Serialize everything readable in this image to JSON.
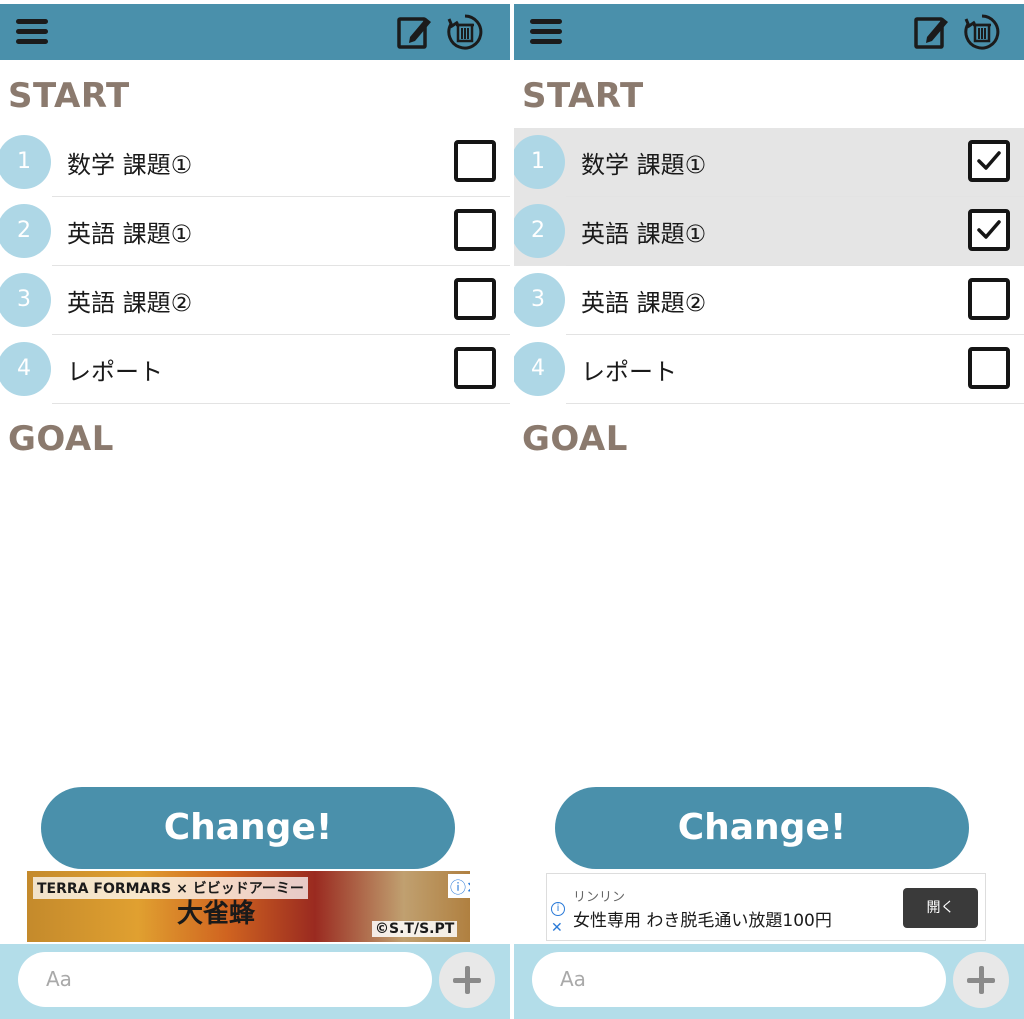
{
  "left_screen": {
    "start_label": "START",
    "goal_label": "GOAL",
    "tasks": [
      {
        "number": "1",
        "text": "数学 課題①",
        "checked": false
      },
      {
        "number": "2",
        "text": "英語 課題①",
        "checked": false
      },
      {
        "number": "3",
        "text": "英語 課題②",
        "checked": false
      },
      {
        "number": "4",
        "text": "レポート",
        "checked": false
      }
    ],
    "change_label": "Change!",
    "ad": {
      "logo_text": "TERRA FORMARS × ビビッドアーミー",
      "title_text": "大雀蜂",
      "copyright": "©S.T/S.PT"
    },
    "input_placeholder": "Aa"
  },
  "right_screen": {
    "start_label": "START",
    "goal_label": "GOAL",
    "tasks": [
      {
        "number": "1",
        "text": "数学 課題①",
        "checked": true
      },
      {
        "number": "2",
        "text": "英語 課題①",
        "checked": true
      },
      {
        "number": "3",
        "text": "英語 課題②",
        "checked": false
      },
      {
        "number": "4",
        "text": "レポート",
        "checked": false
      }
    ],
    "change_label": "Change!",
    "ad": {
      "advertiser": "リンリン",
      "headline": "女性専用 わき脱毛通い放題100円",
      "button_label": "開く"
    },
    "input_placeholder": "Aa"
  },
  "colors": {
    "header": "#4a90ab",
    "number_circle": "#aed7e6",
    "section_label": "#8b7a6e",
    "bottom_bar": "#b3dde9",
    "checked_row": "#e5e5e5"
  },
  "icons": [
    "hamburger-menu-icon",
    "edit-icon",
    "trash-refresh-icon",
    "checkmark-icon",
    "plus-icon"
  ]
}
